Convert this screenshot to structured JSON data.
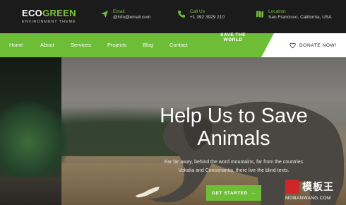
{
  "brand": {
    "word1": "ECO",
    "word2": "GREEN",
    "tagline": "ENVIRONMENT THEME",
    "accent": "#6ebd37"
  },
  "contacts": [
    {
      "icon": "paper-plane-icon",
      "label": "Email:",
      "value": "@info@email.com"
    },
    {
      "icon": "phone-icon",
      "label": "Call Us",
      "value": "+1 392 3929 210"
    },
    {
      "icon": "map-icon",
      "label": "Location",
      "value": "San Francisco, California, USA"
    }
  ],
  "nav": {
    "items": [
      "Home",
      "About",
      "Services",
      "Projects",
      "Blog",
      "Contact"
    ],
    "donate": "DONATE NOW!"
  },
  "hero": {
    "kicker": "SAVE THE WORLD",
    "title_line1": "Help Us to Save",
    "title_line2": "Animals",
    "subtitle_line1": "Far far away, behind the word mountains, far from the countries",
    "subtitle_line2": "Vokalia and Consonantia, there live the blind texts.",
    "cta": "GET STARTED",
    "cta_arrow": "→"
  },
  "watermark": {
    "cn": "模板王",
    "en": "MOBANWANG.COM"
  }
}
